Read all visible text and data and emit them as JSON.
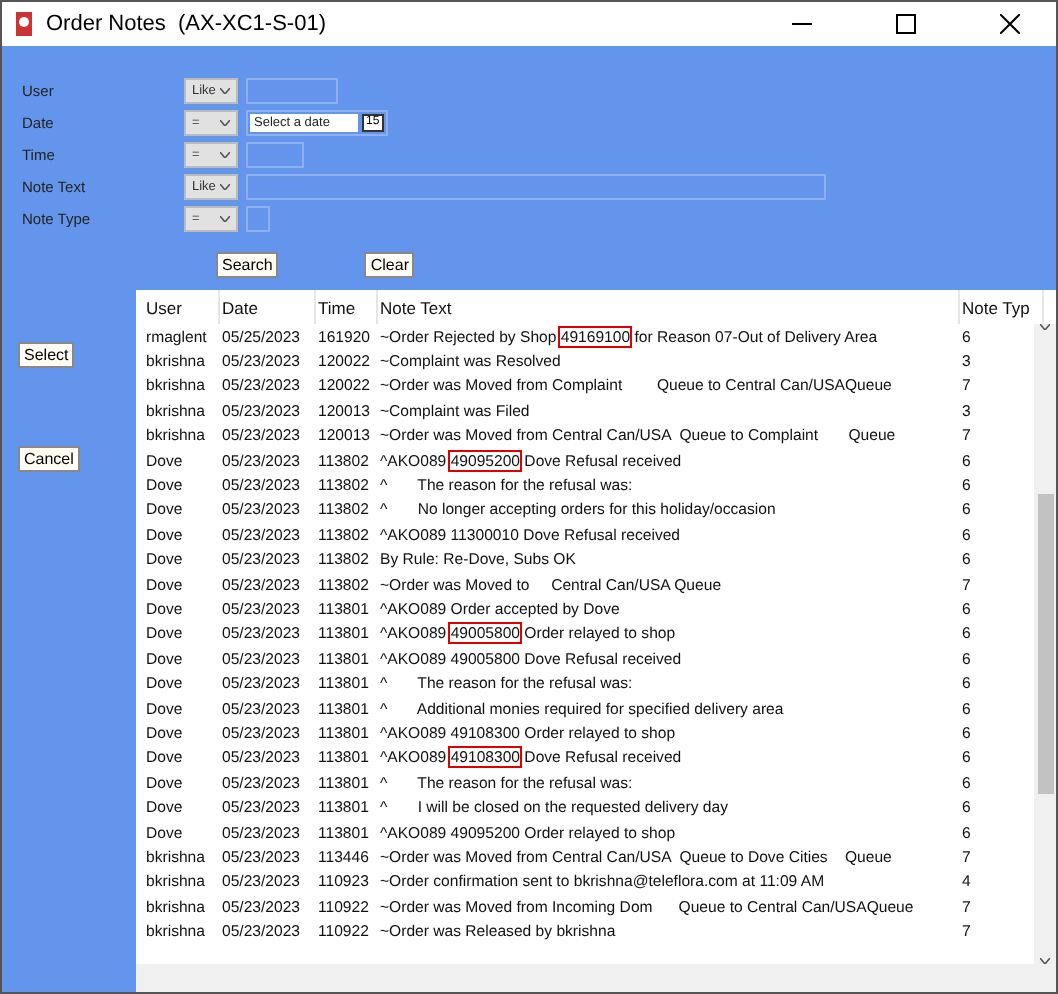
{
  "window": {
    "title": "Order Notes  (AX-XC1-S-01)"
  },
  "filters": [
    {
      "label": "User",
      "operator": "Like",
      "kind": "text"
    },
    {
      "label": "Date",
      "operator": "=",
      "kind": "date",
      "placeholder": "Select a date",
      "calendar": "15"
    },
    {
      "label": "Time",
      "operator": "=",
      "kind": "text"
    },
    {
      "label": "Note Text",
      "operator": "Like",
      "kind": "text"
    },
    {
      "label": "Note Type",
      "operator": "=",
      "kind": "text"
    }
  ],
  "search_button": "Search",
  "clear_button": "Clear",
  "side_buttons": [
    "Select",
    "Cancel"
  ],
  "table": {
    "columns": [
      "User",
      "Date",
      "Time",
      "Note Text",
      "Note Typ"
    ],
    "rows": [
      {
        "user": "rmaglent",
        "date": "05/25/2023",
        "time": "161920",
        "note": [
          {
            "text": "~Order Rejected by Shop ",
            "boxed": false
          },
          {
            "text": "49169100",
            "boxed": true
          },
          {
            "text": " for Reason 07-Out of Delivery Area",
            "boxed": false
          }
        ],
        "type": "6"
      },
      {
        "user": "bkrishna",
        "date": "05/23/2023",
        "time": "120022",
        "note": [
          {
            "text": "~Complaint was Resolved",
            "boxed": false
          }
        ],
        "type": "3"
      },
      {
        "user": "bkrishna",
        "date": "05/23/2023",
        "time": "120022",
        "note": [
          {
            "text": "~Order was Moved from Complaint        Queue to Central Can/USAQueue",
            "boxed": false
          }
        ],
        "type": "7"
      },
      {
        "user": "bkrishna",
        "date": "05/23/2023",
        "time": "120013",
        "note": [
          {
            "text": "~Complaint was Filed",
            "boxed": false
          }
        ],
        "type": "3"
      },
      {
        "user": "bkrishna",
        "date": "05/23/2023",
        "time": "120013",
        "note": [
          {
            "text": "~Order was Moved from Central Can/USA  Queue to Complaint       Queue",
            "boxed": false
          }
        ],
        "type": "7"
      },
      {
        "user": "Dove",
        "date": "05/23/2023",
        "time": "113802",
        "note": [
          {
            "text": "^AKO089 ",
            "boxed": false
          },
          {
            "text": "49095200",
            "boxed": true
          },
          {
            "text": " Dove Refusal received",
            "boxed": false
          }
        ],
        "type": "6"
      },
      {
        "user": "Dove",
        "date": "05/23/2023",
        "time": "113802",
        "note": [
          {
            "text": "^       The reason for the refusal was:",
            "boxed": false
          }
        ],
        "type": "6"
      },
      {
        "user": "Dove",
        "date": "05/23/2023",
        "time": "113802",
        "note": [
          {
            "text": "^       No longer accepting orders for this holiday/occasion",
            "boxed": false
          }
        ],
        "type": "6"
      },
      {
        "user": "Dove",
        "date": "05/23/2023",
        "time": "113802",
        "note": [
          {
            "text": "^AKO089 11300010 Dove Refusal received",
            "boxed": false
          }
        ],
        "type": "6"
      },
      {
        "user": "Dove",
        "date": "05/23/2023",
        "time": "113802",
        "note": [
          {
            "text": "By Rule: Re-Dove, Subs OK",
            "boxed": false
          }
        ],
        "type": "6"
      },
      {
        "user": "Dove",
        "date": "05/23/2023",
        "time": "113802",
        "note": [
          {
            "text": "~Order was Moved to     Central Can/USA Queue",
            "boxed": false
          }
        ],
        "type": "7"
      },
      {
        "user": "Dove",
        "date": "05/23/2023",
        "time": "113801",
        "note": [
          {
            "text": "^AKO089 Order accepted by Dove",
            "boxed": false
          }
        ],
        "type": "6"
      },
      {
        "user": "Dove",
        "date": "05/23/2023",
        "time": "113801",
        "note": [
          {
            "text": "^AKO089 ",
            "boxed": false
          },
          {
            "text": "49005800",
            "boxed": true
          },
          {
            "text": " Order relayed to shop",
            "boxed": false
          }
        ],
        "type": "6"
      },
      {
        "user": "Dove",
        "date": "05/23/2023",
        "time": "113801",
        "note": [
          {
            "text": "^AKO089 49005800 Dove Refusal received",
            "boxed": false
          }
        ],
        "type": "6"
      },
      {
        "user": "Dove",
        "date": "05/23/2023",
        "time": "113801",
        "note": [
          {
            "text": "^       The reason for the refusal was:",
            "boxed": false
          }
        ],
        "type": "6"
      },
      {
        "user": "Dove",
        "date": "05/23/2023",
        "time": "113801",
        "note": [
          {
            "text": "^       Additional monies required for specified delivery area",
            "boxed": false
          }
        ],
        "type": "6"
      },
      {
        "user": "Dove",
        "date": "05/23/2023",
        "time": "113801",
        "note": [
          {
            "text": "^AKO089 49108300 Order relayed to shop",
            "boxed": false
          }
        ],
        "type": "6"
      },
      {
        "user": "Dove",
        "date": "05/23/2023",
        "time": "113801",
        "note": [
          {
            "text": "^AKO089 ",
            "boxed": false
          },
          {
            "text": "49108300",
            "boxed": true
          },
          {
            "text": " Dove Refusal received",
            "boxed": false
          }
        ],
        "type": "6"
      },
      {
        "user": "Dove",
        "date": "05/23/2023",
        "time": "113801",
        "note": [
          {
            "text": "^       The reason for the refusal was:",
            "boxed": false
          }
        ],
        "type": "6"
      },
      {
        "user": "Dove",
        "date": "05/23/2023",
        "time": "113801",
        "note": [
          {
            "text": "^       I will be closed on the requested delivery day",
            "boxed": false
          }
        ],
        "type": "6"
      },
      {
        "user": "Dove",
        "date": "05/23/2023",
        "time": "113801",
        "note": [
          {
            "text": "^AKO089 49095200 Order relayed to shop",
            "boxed": false
          }
        ],
        "type": "6"
      },
      {
        "user": "bkrishna",
        "date": "05/23/2023",
        "time": "113446",
        "note": [
          {
            "text": "~Order was Moved from Central Can/USA  Queue to Dove Cities    Queue",
            "boxed": false
          }
        ],
        "type": "7"
      },
      {
        "user": "bkrishna",
        "date": "05/23/2023",
        "time": "110923",
        "note": [
          {
            "text": "~Order confirmation sent to bkrishna@teleflora.com at 11:09 AM",
            "boxed": false
          }
        ],
        "type": "4"
      },
      {
        "user": "bkrishna",
        "date": "05/23/2023",
        "time": "110922",
        "note": [
          {
            "text": "~Order was Moved from Incoming Dom      Queue to Central Can/USAQueue",
            "boxed": false
          }
        ],
        "type": "7"
      },
      {
        "user": "bkrishna",
        "date": "05/23/2023",
        "time": "110922",
        "note": [
          {
            "text": "~Order was Released by bkrishna",
            "boxed": false
          }
        ],
        "type": "7"
      }
    ]
  }
}
